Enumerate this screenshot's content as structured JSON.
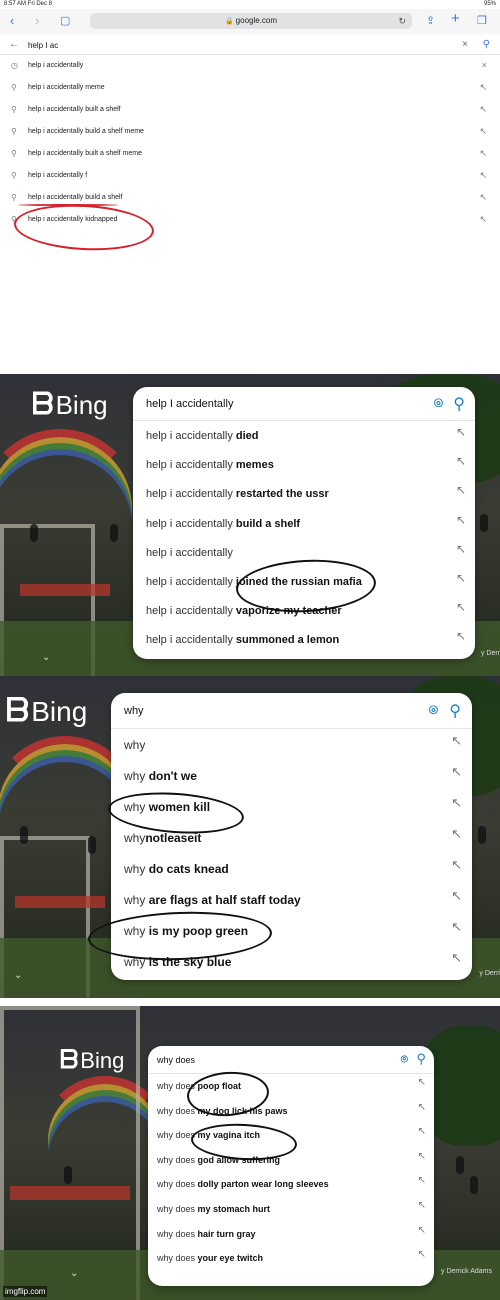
{
  "watermark": "imgflip.com",
  "safari": {
    "status_left": "8:57 AM   Fri Dec 8",
    "status_right": "95%",
    "url": "google.com",
    "query": "help I ac",
    "suggestions": [
      {
        "icon": "history-icon",
        "text": "help i accidentally"
      },
      {
        "icon": "search-icon",
        "text": "help i accidentally meme"
      },
      {
        "icon": "search-icon",
        "text": "help i accidentally built a shelf"
      },
      {
        "icon": "search-icon",
        "text": "help i accidentally build a shelf meme"
      },
      {
        "icon": "search-icon",
        "text": "help i accidentally built a shelf meme"
      },
      {
        "icon": "search-icon",
        "text": "help i accidentally f"
      },
      {
        "icon": "search-icon",
        "text": "help i accidentally build a shelf"
      },
      {
        "icon": "search-icon",
        "text": "help i accidentally kidnapped"
      }
    ]
  },
  "bing1": {
    "logo": "Bing",
    "query": "help I accidentally",
    "suggestions": [
      {
        "prefix": "help i accidentally ",
        "bold": "died"
      },
      {
        "prefix": "help i accidentally ",
        "bold": "memes"
      },
      {
        "prefix": "help i accidentally ",
        "bold": "restarted the ussr"
      },
      {
        "prefix": "help i accidentally ",
        "bold": "build a shelf"
      },
      {
        "prefix": "help i accidentally",
        "bold": ""
      },
      {
        "prefix": "help i accidentally ",
        "bold": "joined the russian mafia"
      },
      {
        "prefix": "help i accidentally ",
        "bold": "vaporize my teacher"
      },
      {
        "prefix": "help i accidentally ",
        "bold": "summoned a lemon"
      }
    ],
    "caption": "y Derr"
  },
  "bing2": {
    "logo": "Bing",
    "query": "why",
    "suggestions": [
      {
        "prefix": "why",
        "bold": ""
      },
      {
        "prefix": "why ",
        "bold": "don't we"
      },
      {
        "prefix": "why ",
        "bold": "women kill"
      },
      {
        "prefix": "why",
        "bold": "notleaseit"
      },
      {
        "prefix": "why ",
        "bold": "do cats knead"
      },
      {
        "prefix": "why ",
        "bold": "are flags at half staff today"
      },
      {
        "prefix": "why ",
        "bold": "is my poop green"
      },
      {
        "prefix": "why ",
        "bold": "is the sky blue"
      }
    ],
    "caption": "y Derri"
  },
  "bing3": {
    "logo": "Bing",
    "query": "why does",
    "suggestions": [
      {
        "prefix": "why does ",
        "bold": "poop float"
      },
      {
        "prefix": "why does ",
        "bold": "my dog lick his paws"
      },
      {
        "prefix": "why does ",
        "bold": "my vagina itch"
      },
      {
        "prefix": "why does ",
        "bold": "god allow suffering"
      },
      {
        "prefix": "why does ",
        "bold": "dolly parton wear long sleeves"
      },
      {
        "prefix": "why does ",
        "bold": "my stomach hurt"
      },
      {
        "prefix": "why does ",
        "bold": "hair turn gray"
      },
      {
        "prefix": "why does ",
        "bold": "your eye twitch"
      }
    ],
    "caption": "y Derrick Adams"
  },
  "colors": {
    "bing_blue": "#1e82c7",
    "safari_blue": "#3478f6",
    "marker_red": "#d2222c",
    "marker_black": "#111111"
  }
}
